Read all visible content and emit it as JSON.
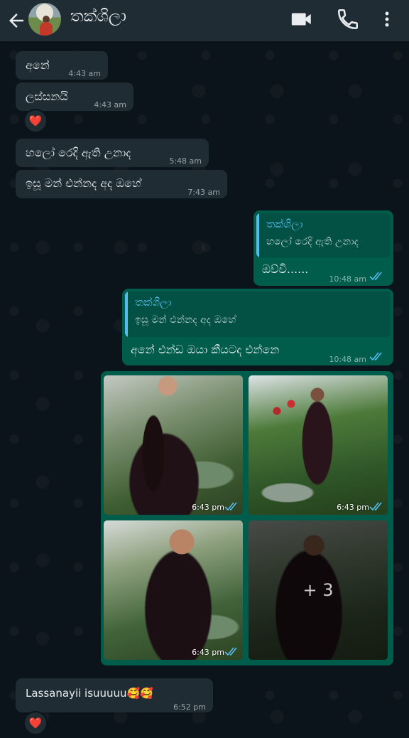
{
  "header": {
    "contact_name": "තක්ශිලා",
    "icons": [
      "back-arrow-icon",
      "video-call-icon",
      "voice-call-icon",
      "more-options-icon"
    ]
  },
  "messages": [
    {
      "direction": "incoming",
      "text": "අනේ",
      "time": "4:43 am"
    },
    {
      "direction": "incoming",
      "text": "ලස්සනයි",
      "time": "4:43 am",
      "reaction": "❤️"
    },
    {
      "direction": "incoming",
      "text": "හලෝ රෙදි ඇති උනාද",
      "time": "5:48 am"
    },
    {
      "direction": "incoming",
      "text": "ඉසූ මන් එන්නද අද ඔහේ",
      "time": "7:43 am"
    },
    {
      "direction": "outgoing",
      "quote_name": "තක්ශිලා",
      "quote_text": "හලෝ රෙදි ඇති උනාද",
      "text": "ඔව්වි......",
      "time": "10:48 am",
      "status": "read"
    },
    {
      "direction": "outgoing",
      "quote_name": "තක්ශිලා",
      "quote_text": "ඉසූ මන් එන්නද අද ඔහේ",
      "text": "අනේ එන්ඩ ඔයා කීයටද එන්නෙ",
      "time": "10:48 am",
      "status": "read"
    },
    {
      "direction": "outgoing",
      "type": "photo_album",
      "photos": [
        {
          "time": "6:43 pm",
          "status": "read"
        },
        {
          "time": "6:43 pm",
          "status": "read"
        },
        {
          "time": "6:43 pm",
          "status": "read"
        },
        {
          "overlay_count": "+ 3"
        }
      ]
    },
    {
      "direction": "incoming",
      "text": "Lassanayii isuuuuu🥰🥰",
      "time": "6:52 pm",
      "reaction": "❤️"
    }
  ],
  "colors": {
    "background": "#0b141a",
    "incoming_bubble": "#1f2c34",
    "outgoing_bubble": "#005c4b",
    "read_ticks": "#53bdeb"
  }
}
